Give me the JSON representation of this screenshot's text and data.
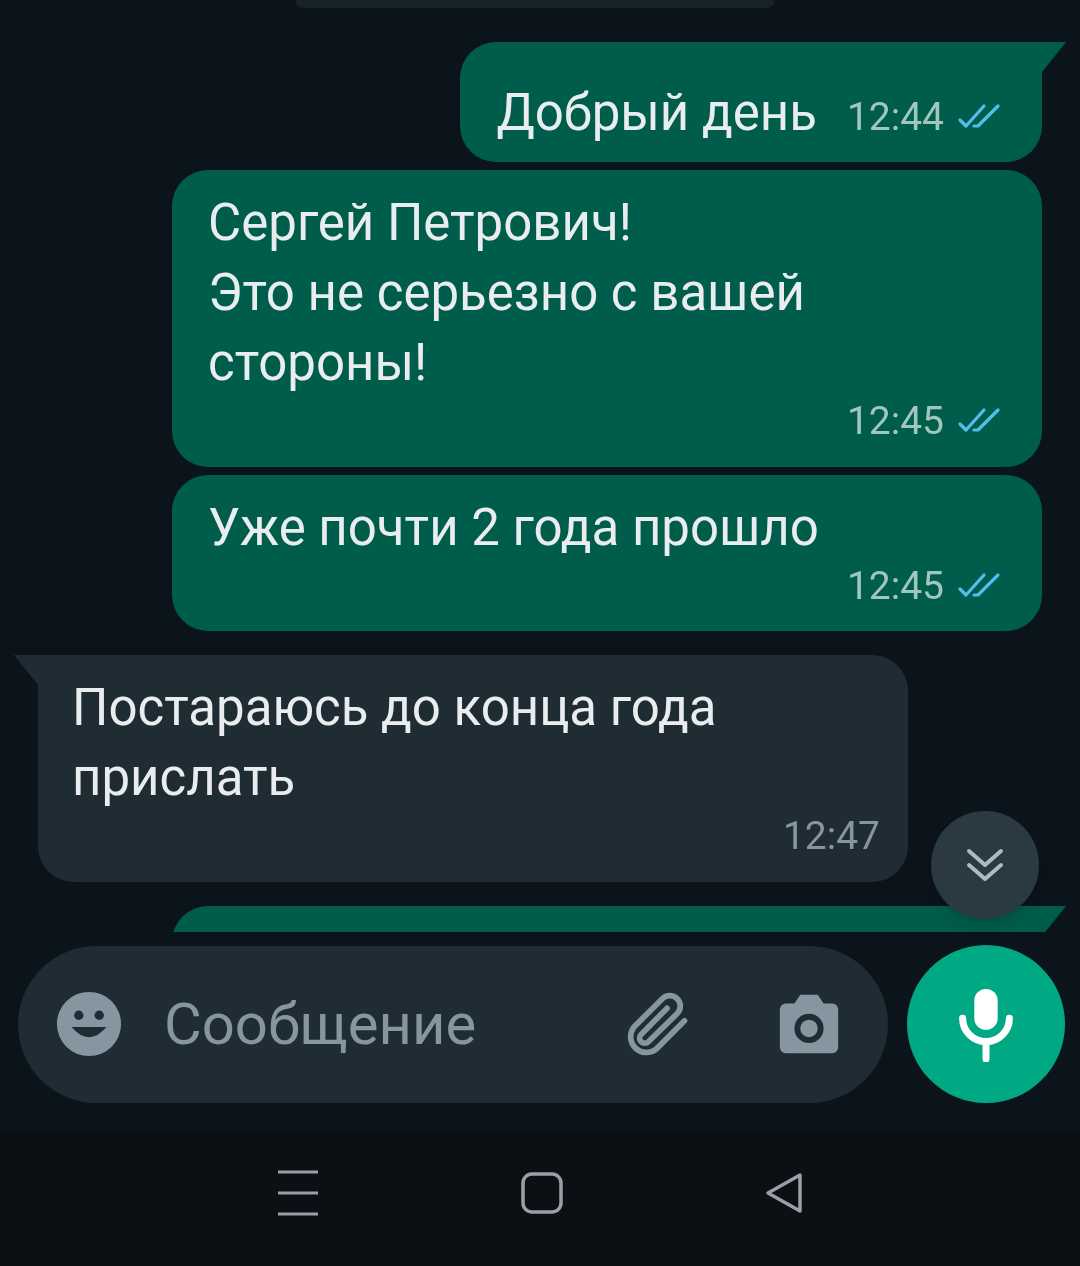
{
  "messages": [
    {
      "kind": "outgoing",
      "tail": true,
      "text": "Добрый день",
      "time": "12:44",
      "read": true
    },
    {
      "kind": "outgoing",
      "tail": false,
      "text": "Сергей Петрович!\nЭто не серьезно с вашей стороны!",
      "time": "12:45",
      "read": true
    },
    {
      "kind": "outgoing",
      "tail": false,
      "text": "Уже почти 2 года прошло",
      "time": "12:45",
      "read": true
    },
    {
      "kind": "incoming",
      "tail": true,
      "text": "Постараюсь до конца года прислать",
      "time": "12:47"
    },
    {
      "kind": "outgoing",
      "tail": true
    }
  ],
  "composer": {
    "placeholder": "Сообщение"
  }
}
